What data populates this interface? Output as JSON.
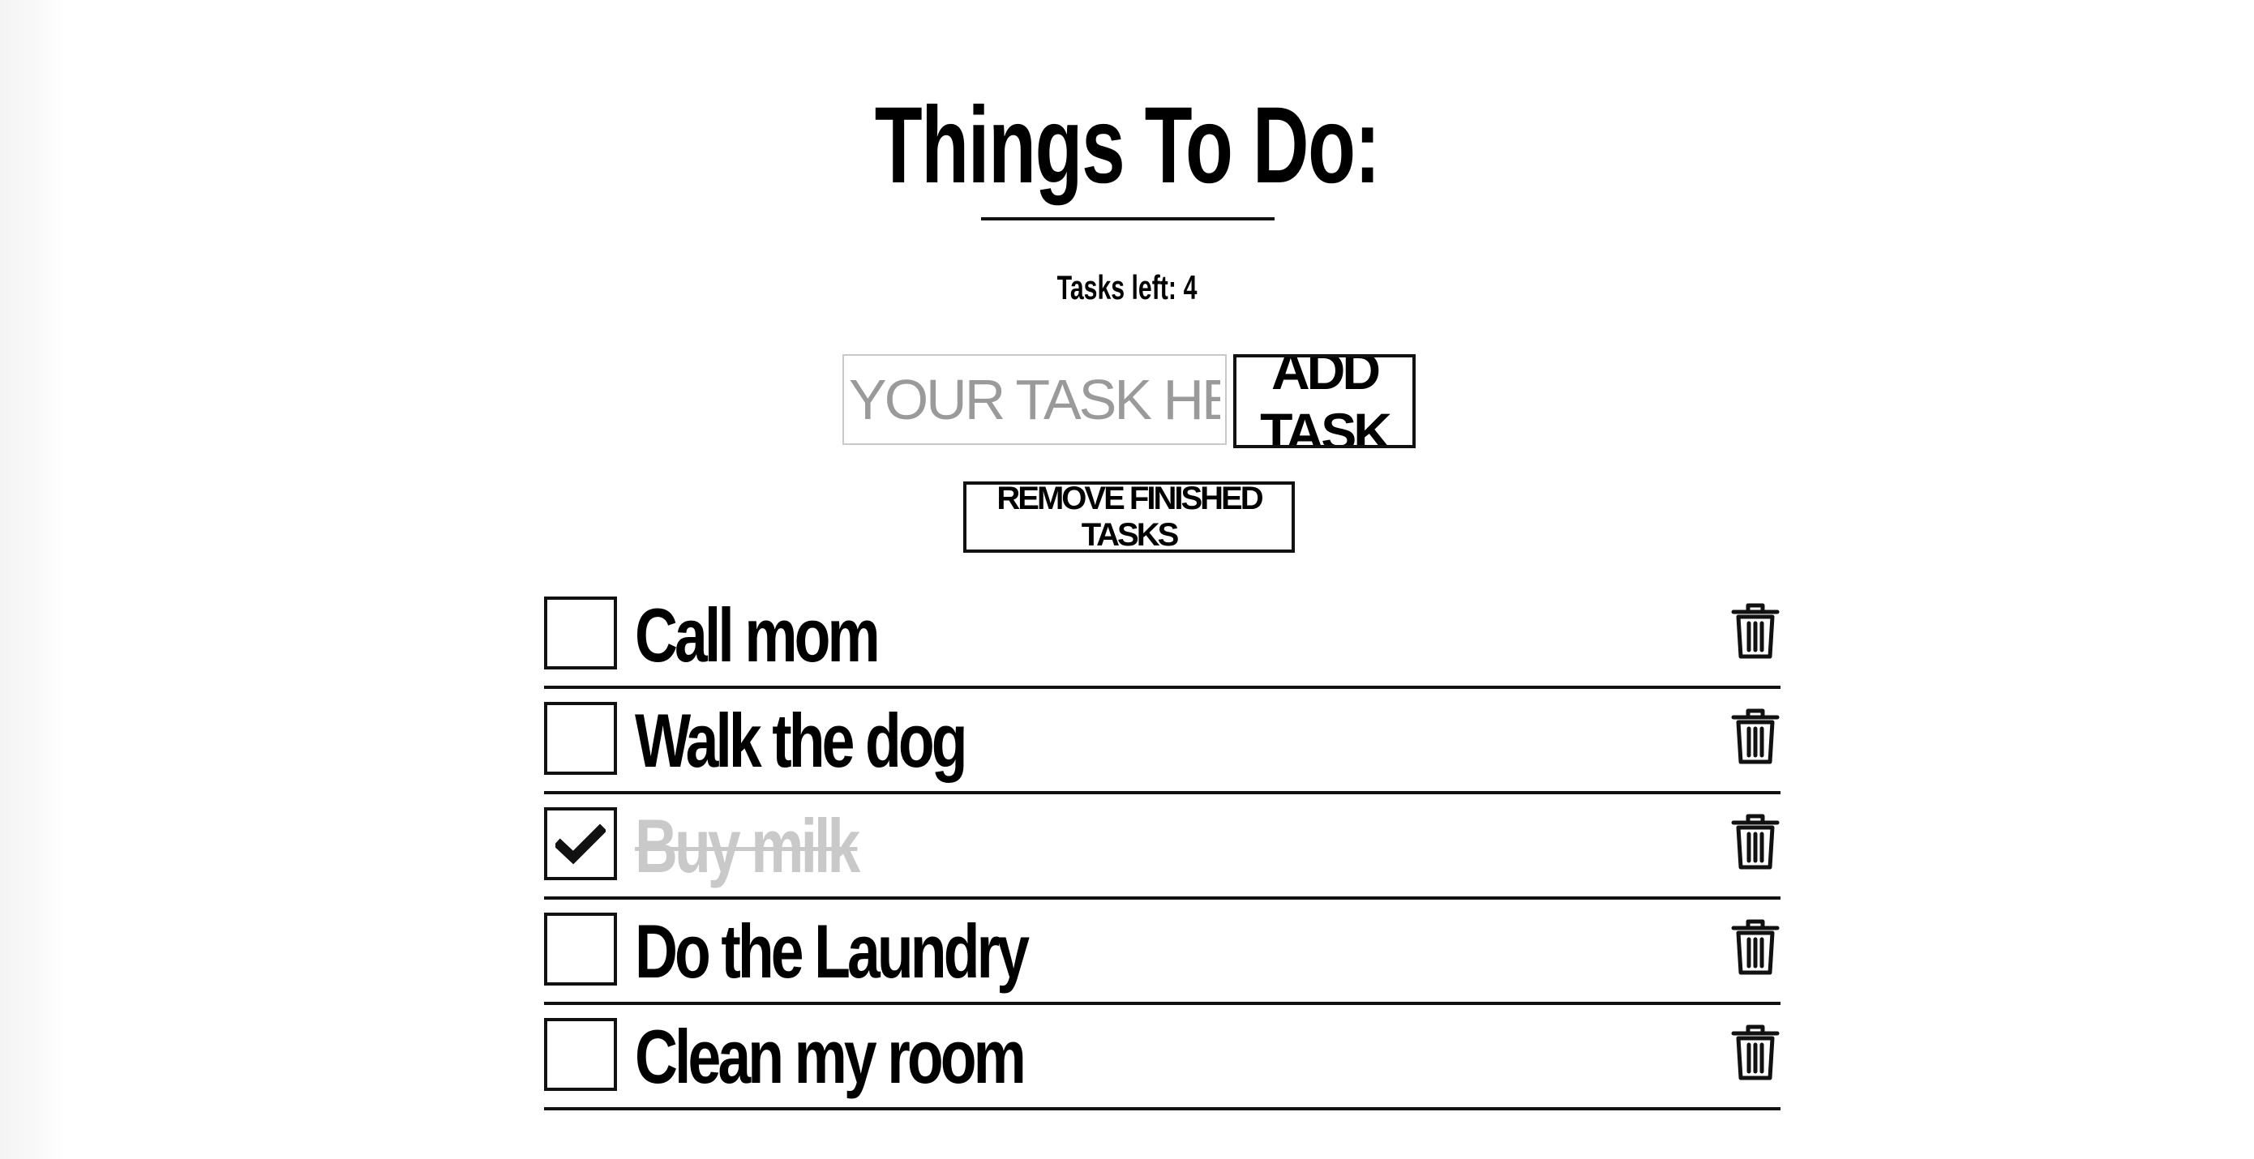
{
  "app": {
    "title": "Things To Do:"
  },
  "status": {
    "tasks_left_label": "Tasks left:",
    "tasks_left_count": "4"
  },
  "add_form": {
    "input_placeholder": "YOUR TASK HERE",
    "input_value": "",
    "add_button_label": "ADD TASK"
  },
  "actions": {
    "remove_finished_label": "REMOVE FINISHED TASKS"
  },
  "tasks": [
    {
      "text": "Call mom",
      "done": false,
      "delete_icon": "trash-icon"
    },
    {
      "text": "Walk the dog",
      "done": false,
      "delete_icon": "trash-icon"
    },
    {
      "text": "Buy milk",
      "done": true,
      "delete_icon": "trash-icon"
    },
    {
      "text": "Do the Laundry",
      "done": false,
      "delete_icon": "trash-icon"
    },
    {
      "text": "Clean my room",
      "done": false,
      "delete_icon": "trash-icon"
    }
  ],
  "colors": {
    "text": "#000000",
    "done_text": "#c9c9c9",
    "border": "#111111",
    "input_border": "#c8c8c8",
    "placeholder": "#9a9a9a"
  }
}
